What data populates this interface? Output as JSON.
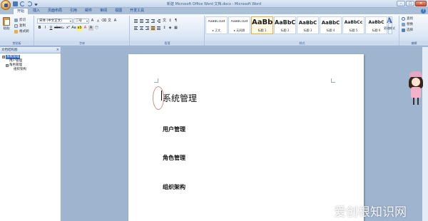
{
  "window": {
    "title": "新建 Microsoft Office Word 文档.docx - Microsoft Word"
  },
  "ribbon_tabs": [
    "开始",
    "插入",
    "页面布局",
    "引用",
    "邮件",
    "审阅",
    "视图",
    "开发工具"
  ],
  "clipboard": {
    "paste": "粘贴",
    "cut": "剪切",
    "copy": "复制",
    "format_painter": "格式刷",
    "group_label": "剪贴板"
  },
  "font": {
    "family": "宋体 (中文正文)",
    "size": "二号",
    "group_label": "字体"
  },
  "paragraph": {
    "group_label": "段落"
  },
  "styles": {
    "tiles": [
      {
        "sample": "AaBbCcDd",
        "name": "▸ 正文"
      },
      {
        "sample": "AaBbCcDd",
        "name": "▸ 无间隔"
      },
      {
        "sample": "AaBb",
        "name": "标题 1"
      },
      {
        "sample": "AaBbC",
        "name": "标题 2"
      },
      {
        "sample": "AaBbC",
        "name": "标题 3"
      },
      {
        "sample": "AaBbC",
        "name": "标题 4"
      },
      {
        "sample": "AaBbCc",
        "name": "标题 5"
      },
      {
        "sample": "AaBbC",
        "name": "标题 6"
      }
    ],
    "change_styles": "更改样式",
    "group_label": "样式"
  },
  "editing": {
    "find": "查找",
    "replace": "替换",
    "select": "选择",
    "group_label": "编辑"
  },
  "navpane": {
    "title": "文档结构图",
    "close": "×",
    "tree": [
      {
        "label": "系统管理",
        "level": 0,
        "toggle": "⊟",
        "selected": true
      },
      {
        "label": "用户管理",
        "level": 1,
        "toggle": "",
        "selected": false
      },
      {
        "label": "角色管理",
        "level": 1,
        "toggle": "⊟",
        "selected": false
      },
      {
        "label": "组织架构",
        "level": 2,
        "toggle": "",
        "selected": false
      }
    ]
  },
  "document": {
    "heading1": "系统管理",
    "headings2": [
      "用户管理",
      "角色管理",
      "组织架构"
    ]
  },
  "watermark": "爱创根知识网"
}
